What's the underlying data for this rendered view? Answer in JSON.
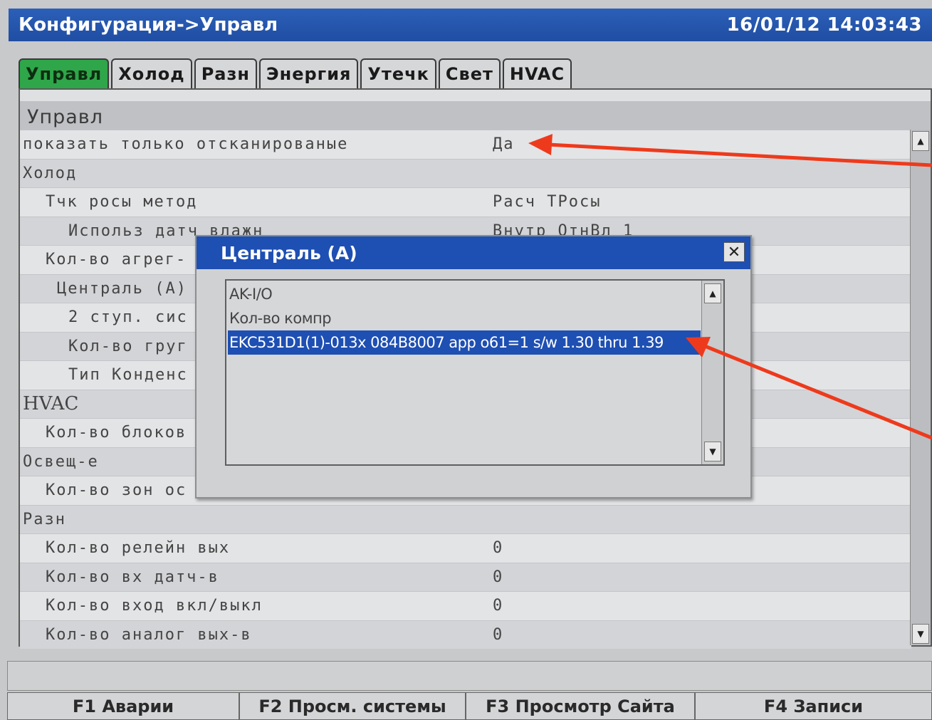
{
  "window": {
    "title": "Конфигурация->Управл",
    "datetime": "16/01/12 14:03:43"
  },
  "tabs": [
    {
      "label": "Управл",
      "active": true
    },
    {
      "label": "Холод"
    },
    {
      "label": "Разн"
    },
    {
      "label": "Энергия"
    },
    {
      "label": "Утечк"
    },
    {
      "label": "Свет"
    },
    {
      "label": "HVAC"
    }
  ],
  "panel": {
    "header": "Управл",
    "rows": [
      {
        "label": "показать только отсканированые",
        "value": "Да"
      },
      {
        "label": "Холод",
        "value": ""
      },
      {
        "label": "Тчк росы метод",
        "value": "Расч ТРосы"
      },
      {
        "label": "Использ датч влажн",
        "value": "Внутр ОтнВл 1"
      },
      {
        "label": "Кол-во агрег-",
        "value": ""
      },
      {
        "label": "Централь (A)",
        "value": ""
      },
      {
        "label": "2 ступ. сис",
        "value": ""
      },
      {
        "label": "Кол-во груг",
        "value": ""
      },
      {
        "label": "Тип Конденс",
        "value": ""
      },
      {
        "label": "HVAC",
        "value": ""
      },
      {
        "label": "Кол-во блоков",
        "value": ""
      },
      {
        "label": "Освещ-е",
        "value": ""
      },
      {
        "label": "Кол-во зон ос",
        "value": ""
      },
      {
        "label": "Разн",
        "value": ""
      },
      {
        "label": "Кол-во релейн вых",
        "value": "0"
      },
      {
        "label": "Кол-во вх датч-в",
        "value": "0"
      },
      {
        "label": "Кол-во вход вкл/выкл",
        "value": "0"
      },
      {
        "label": "Кол-во аналог вых-в",
        "value": "0"
      }
    ]
  },
  "dialog": {
    "title": "Централь (A)",
    "close_glyph": "✕",
    "options": [
      {
        "label": "AK-I/O"
      },
      {
        "label": "Кол-во компр"
      },
      {
        "label": "EKC531D1(1)-013x 084B8007 app o61=1 s/w 1.30 thru 1.39",
        "selected": true
      }
    ]
  },
  "scroll": {
    "up_glyph": "▲",
    "down_glyph": "▼"
  },
  "function_keys": [
    {
      "label": "F1 Аварии"
    },
    {
      "label": "F2 Просм. системы"
    },
    {
      "label": "F3 Просмотр Сайта"
    },
    {
      "label": "F4 Записи"
    }
  ],
  "colors": {
    "titlebar": "#1f4ea3",
    "active_tab": "#2fa64a",
    "selection": "#1e4fb3",
    "annotation_arrow": "#ee3a1c"
  }
}
